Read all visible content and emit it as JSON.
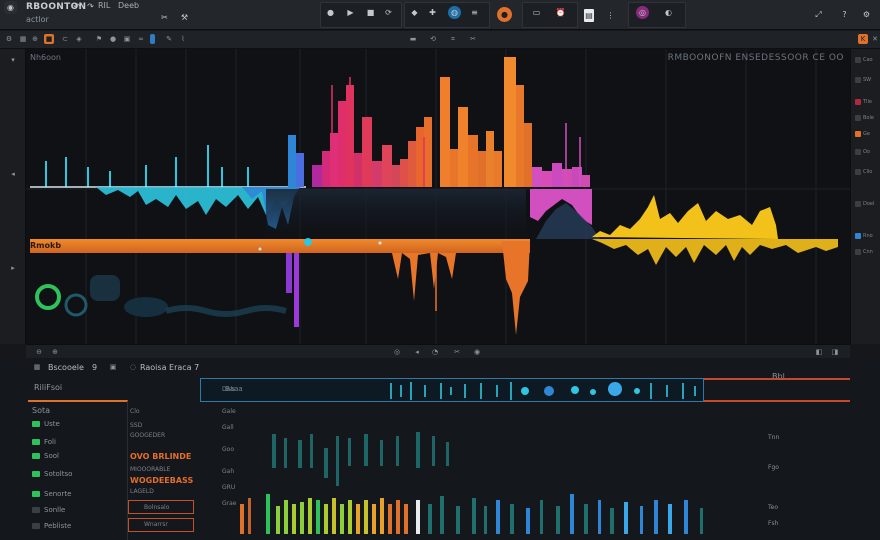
{
  "app": {
    "brand": "RBOONTON",
    "brand_sub": "actlor",
    "menu": [
      "RIL",
      "Deeb"
    ]
  },
  "toolbar2": {
    "icons": [
      "grid-icon",
      "pencil-icon",
      "snap-icon",
      "loop-icon",
      "eye-icon"
    ]
  },
  "wave_view": {
    "track_label": "Nh6oon",
    "title": "RMBOONOFN ENSEDESSOOR  CE OO",
    "orange_bar_label": "Rmokb"
  },
  "right_panel": {
    "items": [
      {
        "label": "Cao",
        "color": "#3a3f46"
      },
      {
        "label": "SW",
        "color": "#3a3f46"
      },
      {
        "label": "Tlle",
        "color": "#b02740"
      },
      {
        "label": "Bole",
        "color": "#3a3f46"
      },
      {
        "label": "Ge",
        "color": "#e0712a"
      },
      {
        "label": "Oo",
        "color": "#3a3f46"
      },
      {
        "label": "Cllo",
        "color": "#3a3f46"
      },
      {
        "label": "Doel",
        "color": "#3a3f46"
      },
      {
        "label": "Rno",
        "color": "#2f86d6"
      },
      {
        "label": "Cnn",
        "color": "#3a3f46"
      }
    ]
  },
  "lower": {
    "header_left": "Bscooele",
    "header_num": "9",
    "header_mid": "Raoisa Eraca 7",
    "sub_label": "RiliFsoi",
    "tree_title": "Sota",
    "tree": [
      "Uste",
      "Foli",
      "Sool",
      "Sotoltso",
      "Senorte",
      "Sonlle",
      "Pebliste"
    ],
    "params": [
      "Clo",
      "SSD",
      "GOOGEDER",
      "OVO BRLINDE",
      "MIOOORABLE",
      "WOGDEEBASS",
      "LAGELD",
      "Bolnsalo",
      "Wnarrsr"
    ],
    "values": [
      "Dnls",
      "Gale",
      "Gall",
      "Goo",
      "Gah",
      "GRU",
      "Grae"
    ],
    "right_col": [
      "Bbl",
      "Tnn",
      "Fgo",
      "Teo",
      "Fsh"
    ],
    "lane_label": "Baaa"
  },
  "colors": {
    "accent_orange": "#e0712a",
    "cyan": "#2ec6e0",
    "magenta": "#e02e7e",
    "yellow": "#f2c21a",
    "green": "#2ec25c"
  }
}
